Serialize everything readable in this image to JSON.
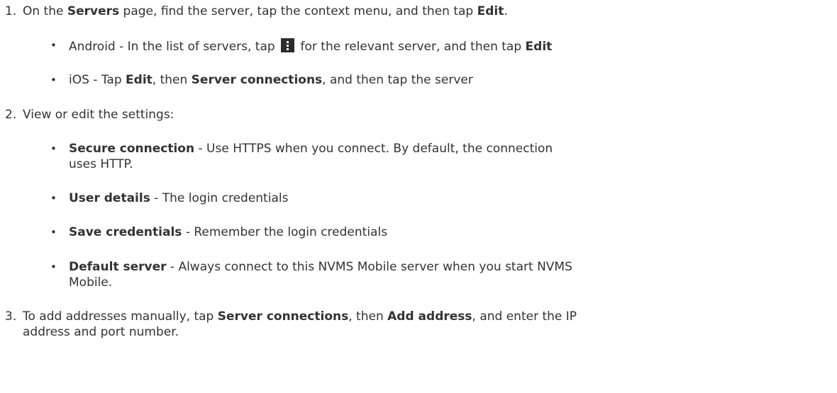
{
  "steps": [
    {
      "number": "1.",
      "parts": [
        "On the ",
        "Servers",
        " page, find the server, tap the context menu, and then tap ",
        "Edit",
        "."
      ],
      "bullets": [
        {
          "marker": "•",
          "parts": [
            "Android - In the list of servers, tap ",
            " for the relevant server, and then tap ",
            "Edit"
          ],
          "icon": "more-vert-icon"
        },
        {
          "marker": "•",
          "parts": [
            "iOS - Tap ",
            "Edit",
            ", then ",
            "Server connections",
            ", and then tap the server"
          ]
        }
      ]
    },
    {
      "number": "2.",
      "text": "View or edit the settings:",
      "bullets": [
        {
          "marker": "•",
          "term": "Secure connection",
          "desc_line1": " - Use HTTPS when you connect. By default, the connection",
          "desc_line2": "uses HTTP."
        },
        {
          "marker": "•",
          "term": "User details",
          "desc": " - The login credentials"
        },
        {
          "marker": "•",
          "term": "Save credentials",
          "desc": " - Remember the login credentials"
        },
        {
          "marker": "•",
          "term": "Default server",
          "desc_line1": " - Always connect to this NVMS Mobile server when you start NVMS",
          "desc_line2": "Mobile."
        }
      ]
    },
    {
      "number": "3.",
      "parts": [
        "To add addresses manually, tap ",
        "Server connections",
        ", then ",
        "Add address",
        ", and enter the IP"
      ],
      "line2": "address and port number."
    }
  ]
}
